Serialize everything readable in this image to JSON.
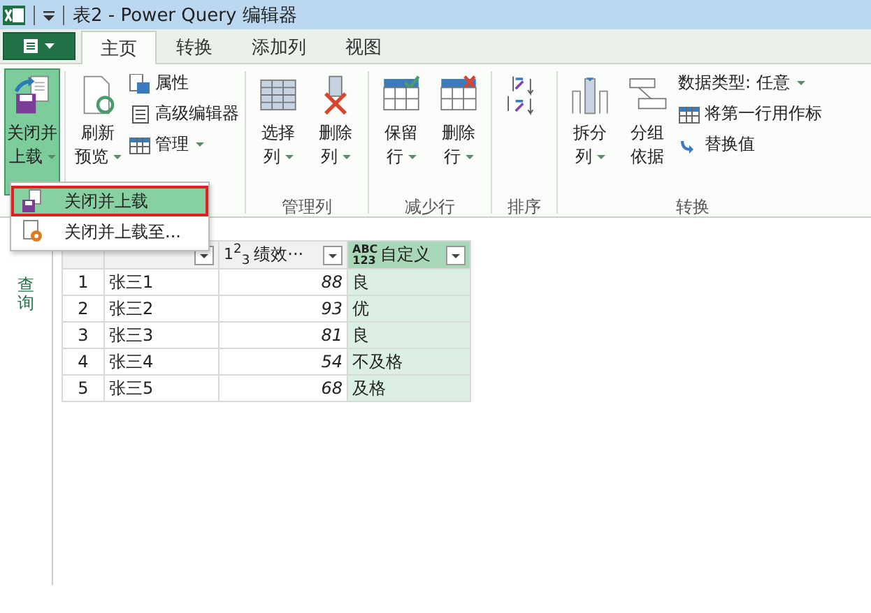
{
  "title_bar": {
    "title": "表2 - Power Query 编辑器"
  },
  "tabs": [
    {
      "label": "主页",
      "selected": true
    },
    {
      "label": "转换",
      "selected": false
    },
    {
      "label": "添加列",
      "selected": false
    },
    {
      "label": "视图",
      "selected": false
    }
  ],
  "ribbon_groups": [
    {
      "large": [
        {
          "lines": [
            "关闭并",
            "上载"
          ],
          "kind": "close-load",
          "dropdown": true,
          "selected": true
        }
      ]
    },
    {
      "large": [
        {
          "lines": [
            "刷新",
            "预览"
          ],
          "kind": "refresh",
          "dropdown": true,
          "selected": false
        }
      ],
      "small": [
        {
          "label": "属性",
          "kind": "properties"
        },
        {
          "label": "高级编辑器",
          "kind": "editor"
        },
        {
          "label": "管理",
          "kind": "table",
          "dropdown": true
        }
      ]
    },
    {
      "label": "管理列",
      "large": [
        {
          "lines": [
            "选择",
            "列"
          ],
          "kind": "choose-columns",
          "dropdown": true,
          "selected": false
        },
        {
          "lines": [
            "删除",
            "列"
          ],
          "kind": "remove-columns",
          "dropdown": true,
          "selected": false
        }
      ]
    },
    {
      "label": "减少行",
      "large": [
        {
          "lines": [
            "保留",
            "行"
          ],
          "kind": "keep-rows",
          "dropdown": true,
          "selected": false
        },
        {
          "lines": [
            "删除",
            "行"
          ],
          "kind": "remove-rows",
          "dropdown": true,
          "selected": false
        }
      ]
    },
    {
      "label": "排序",
      "large": [
        {
          "kind": "sort",
          "selected": false
        }
      ]
    },
    {
      "label": "转换",
      "large": [
        {
          "lines": [
            "拆分",
            "列"
          ],
          "kind": "split",
          "dropdown": true,
          "selected": false
        },
        {
          "lines": [
            "分组",
            "依据"
          ],
          "kind": "group",
          "selected": false
        }
      ],
      "small": [
        {
          "label": "数据类型: 任意",
          "kind": "plain",
          "dropdown": true
        },
        {
          "label": "将第一行用作标",
          "kind": "table"
        },
        {
          "label": "替换值",
          "kind": "replace"
        }
      ]
    }
  ],
  "menu": [
    {
      "label": "关闭并上载",
      "kind": "close-load",
      "selected": true
    },
    {
      "label": "关闭并上载至...",
      "kind": "load-to",
      "selected": false
    }
  ],
  "side_panel": {
    "label": "查询"
  },
  "table": {
    "columns": [
      {
        "kind": "index"
      },
      {
        "kind": "text"
      },
      {
        "kind": "number",
        "type": "1$^{2}$$_{3}$",
        "name": "绩效···"
      },
      {
        "kind": "any",
        "type": "ABC 123",
        "name": "自定义"
      }
    ],
    "rows": [
      [
        "1",
        "张三1",
        "88",
        "良"
      ],
      [
        "2",
        "张三2",
        "93",
        "优"
      ],
      [
        "3",
        "张三3",
        "81",
        "良"
      ],
      [
        "4",
        "张三4",
        "54",
        "不及格"
      ],
      [
        "5",
        "张三5",
        "68",
        "及格"
      ]
    ]
  }
}
